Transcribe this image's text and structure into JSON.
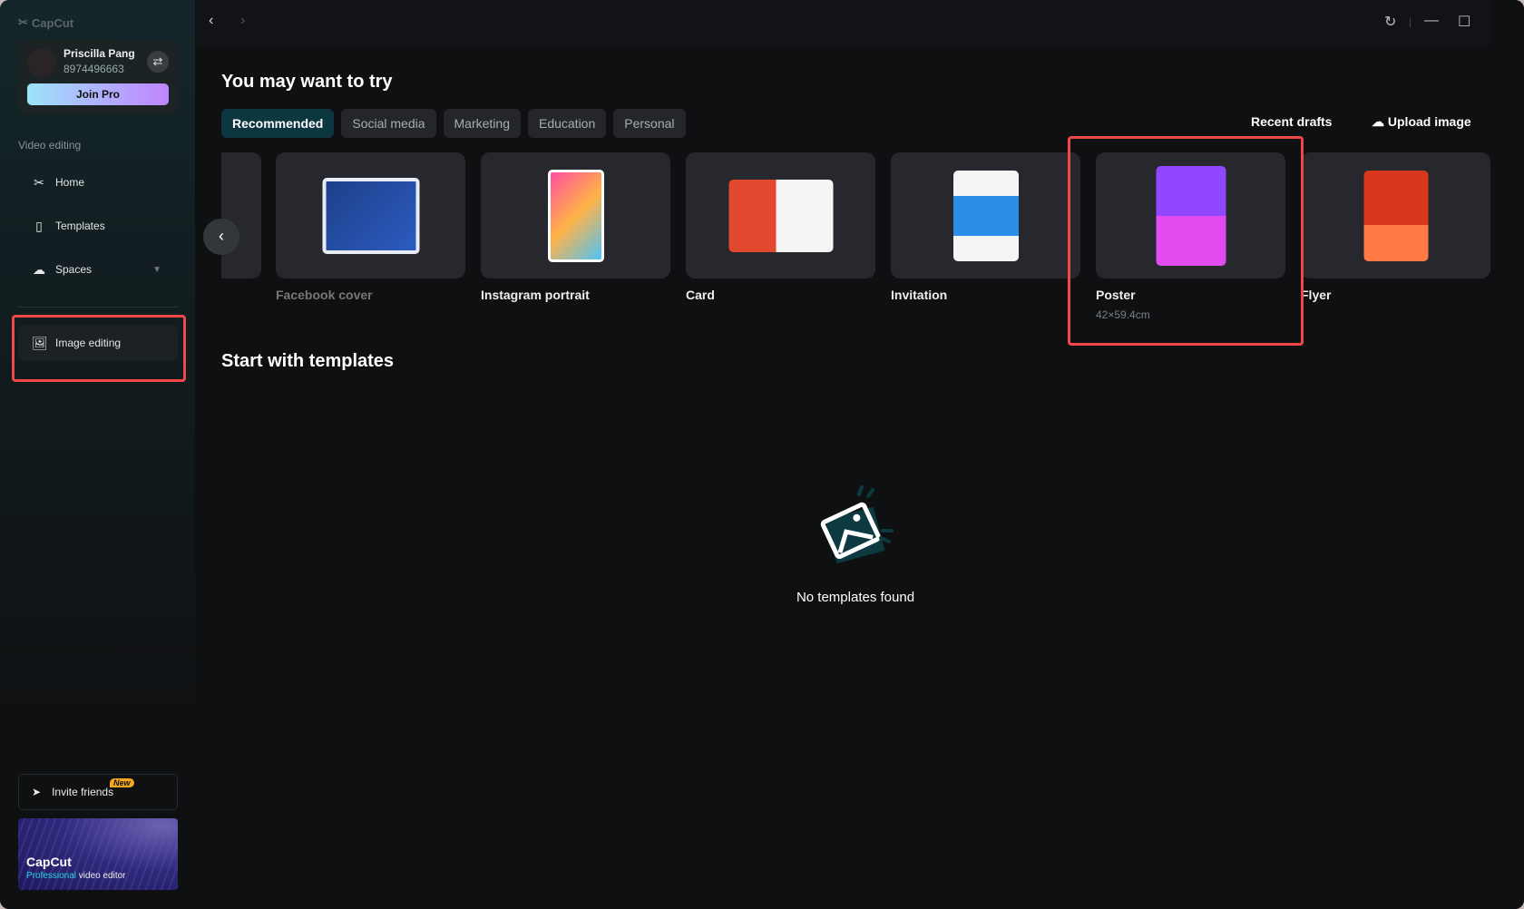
{
  "app": {
    "name": "CapCut"
  },
  "account": {
    "name": "Priscilla Pang",
    "id": "8974496663",
    "join_pro": "Join Pro"
  },
  "sidebar": {
    "section": "Video editing",
    "items": [
      {
        "label": "Home"
      },
      {
        "label": "Templates"
      },
      {
        "label": "Spaces"
      },
      {
        "label": "Image editing"
      }
    ],
    "invite": "Invite friends",
    "new_badge": "New",
    "promo_title": "CapCut",
    "promo_sub_accent": "Professional",
    "promo_sub": " video editor"
  },
  "main": {
    "title": "You may want to try",
    "tabs": [
      "Recommended",
      "Social media",
      "Marketing",
      "Education",
      "Personal"
    ],
    "recent_drafts": "Recent drafts",
    "upload_image": "Upload image",
    "cards": [
      {
        "label": "Facebook cover"
      },
      {
        "label": "Instagram portrait"
      },
      {
        "label": "Card"
      },
      {
        "label": "Invitation"
      },
      {
        "label": "Poster",
        "size": "42×59.4cm"
      },
      {
        "label": "Flyer"
      }
    ],
    "templates_title": "Start with templates",
    "empty": "No templates found"
  },
  "colors": {
    "accent_tab": "#0c3640",
    "highlight": "#f04848"
  }
}
